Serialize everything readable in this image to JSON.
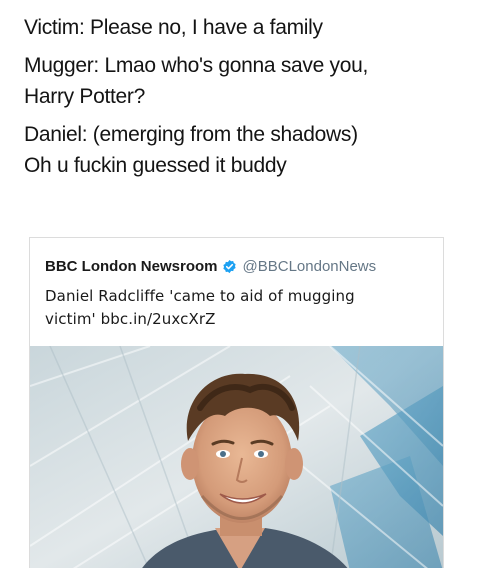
{
  "meme": {
    "victim_line": "Victim: Please no, I have a family",
    "mugger_line1": "Mugger: Lmao who's gonna save you,",
    "mugger_line2": "Harry Potter?",
    "daniel_line1": "Daniel: (emerging from the shadows)",
    "daniel_line2": "Oh u fuckin guessed it buddy"
  },
  "tweet": {
    "account_name": "BBC London Newsroom",
    "handle": "@BBCLondonNews",
    "text_line1": "Daniel Radcliffe 'came to aid of mugging",
    "text_line2": "victim' bbc.in/2uxcXrZ",
    "verified_icon": "verified-badge-icon",
    "accent_color": "#1da1f2"
  }
}
